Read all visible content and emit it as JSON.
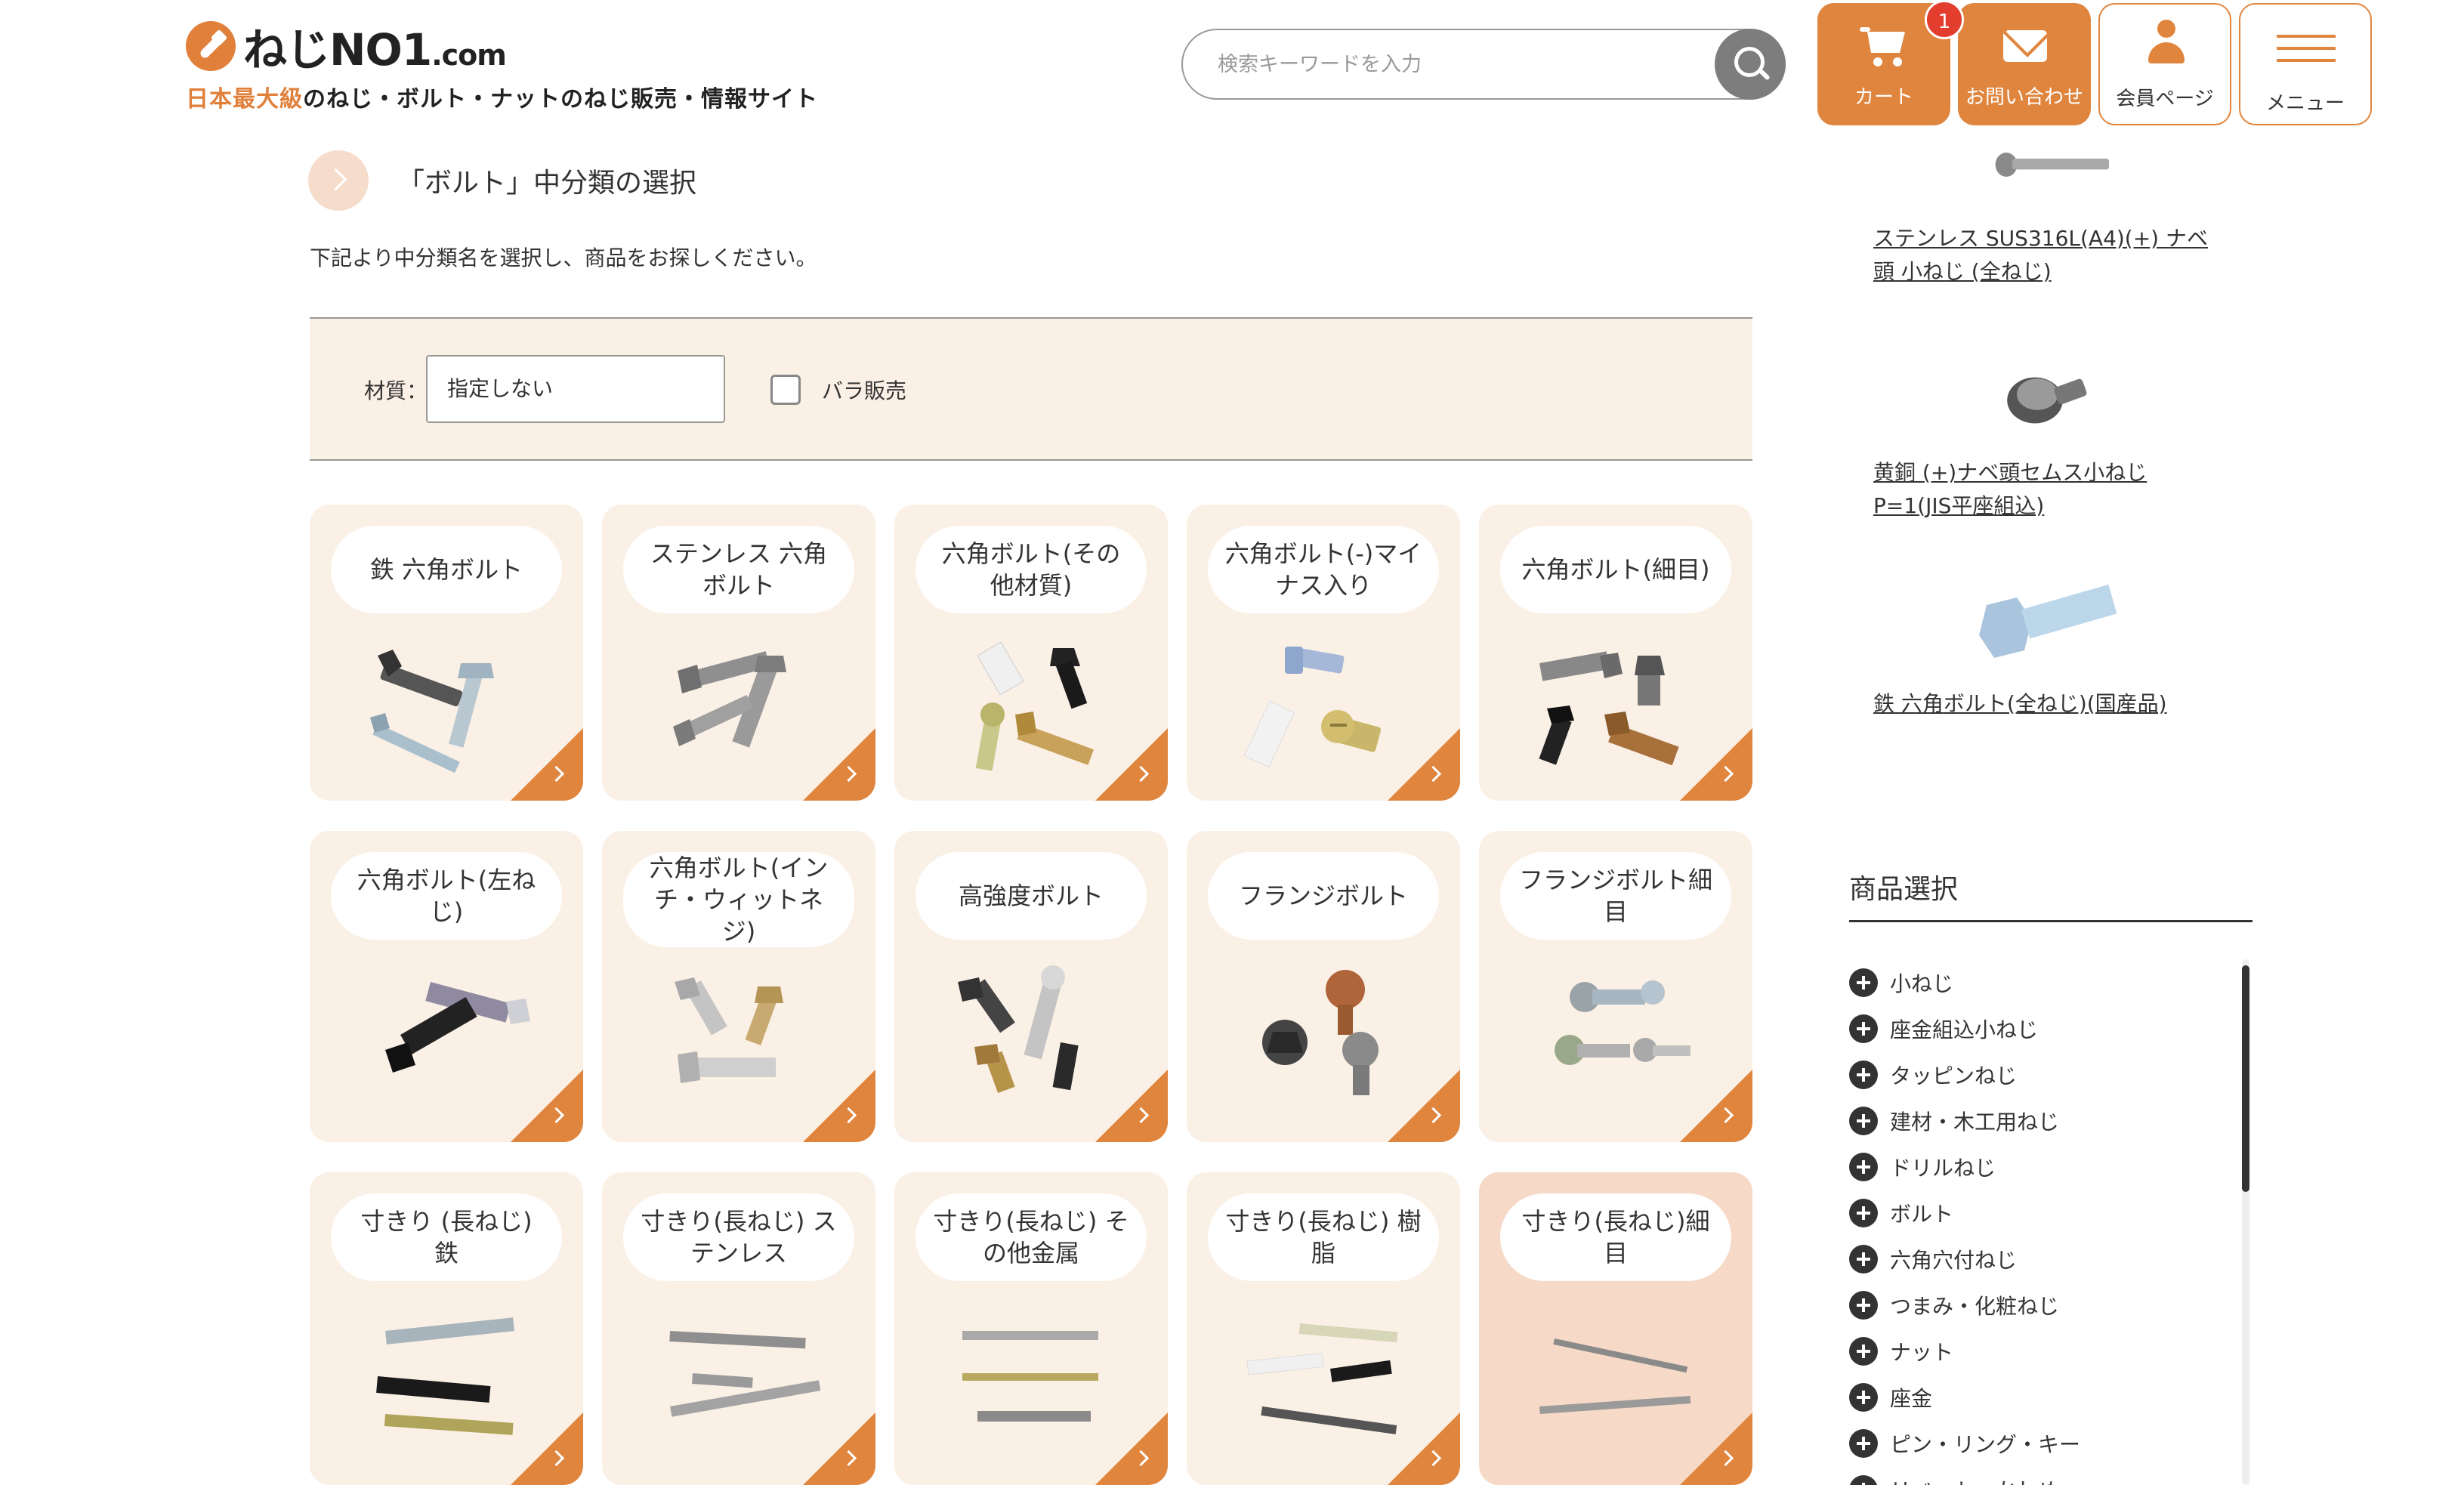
{
  "header": {
    "logo_text": "ねじNO1",
    "logo_suffix": ".com",
    "tagline_accent": "日本最大級",
    "tagline_rest": "のねじ・ボルト・ナットのねじ販売・情報サイト",
    "search_placeholder": "検索キーワードを入力",
    "cart_label": "カート",
    "cart_count": "1",
    "contact_label": "お問い合わせ",
    "member_label": "会員ページ",
    "menu_label": "メニュー",
    "accent_color": "#e0853e"
  },
  "main": {
    "page_title": "「ボルト」中分類の選択",
    "intro": "下記より中分類名を選択し、商品をお探しください。",
    "filter": {
      "material_label": "材質：",
      "material_value": "指定しない",
      "bara_label": "バラ販売",
      "bara_checked": false
    },
    "categories": [
      {
        "name": "鉄 六角ボルト",
        "icon": "hex-bolt-iron-image"
      },
      {
        "name": "ステンレス 六角ボルト",
        "icon": "hex-bolt-stainless-image"
      },
      {
        "name": "六角ボルト(その他材質)",
        "icon": "hex-bolt-other-material-image"
      },
      {
        "name": "六角ボルト(-)マイナス入り",
        "icon": "hex-bolt-slotted-image"
      },
      {
        "name": "六角ボルト(細目)",
        "icon": "hex-bolt-fine-thread-image"
      },
      {
        "name": "六角ボルト(左ねじ)",
        "icon": "hex-bolt-left-hand-image"
      },
      {
        "name": "六角ボルト(インチ・ウィットネジ)",
        "icon": "hex-bolt-inch-image"
      },
      {
        "name": "高強度ボルト",
        "icon": "high-strength-bolt-image"
      },
      {
        "name": "フランジボルト",
        "icon": "flange-bolt-image"
      },
      {
        "name": "フランジボルト細目",
        "icon": "flange-bolt-fine-image"
      },
      {
        "name": "寸きり (長ねじ) 鉄",
        "icon": "threaded-rod-iron-image"
      },
      {
        "name": "寸きり(長ねじ) ステンレス",
        "icon": "threaded-rod-stainless-image"
      },
      {
        "name": "寸きり(長ねじ) その他金属",
        "icon": "threaded-rod-other-metal-image"
      },
      {
        "name": "寸きり(長ねじ) 樹脂",
        "icon": "threaded-rod-resin-image"
      },
      {
        "name": "寸きり(長ねじ)細目",
        "icon": "threaded-rod-fine-image"
      }
    ]
  },
  "sidebar": {
    "products": [
      {
        "name": "ステンレス SUS316L(A4)(+) ナベ頭 小ねじ (全ねじ)"
      },
      {
        "name": "黄銅 (+)ナベ頭セムス小ねじ P=1(JIS平座組込)"
      },
      {
        "name": "鉄 六角ボルト(全ねじ)(国産品)"
      }
    ],
    "heading": "商品選択",
    "categories": [
      "小ねじ",
      "座金組込小ねじ",
      "タッピンねじ",
      "建材・木工用ねじ",
      "ドリルねじ",
      "ボルト",
      "六角穴付ねじ",
      "つまみ・化粧ねじ",
      "ナット",
      "座金",
      "ピン・リング・キー",
      "リベット・かしめ"
    ]
  }
}
